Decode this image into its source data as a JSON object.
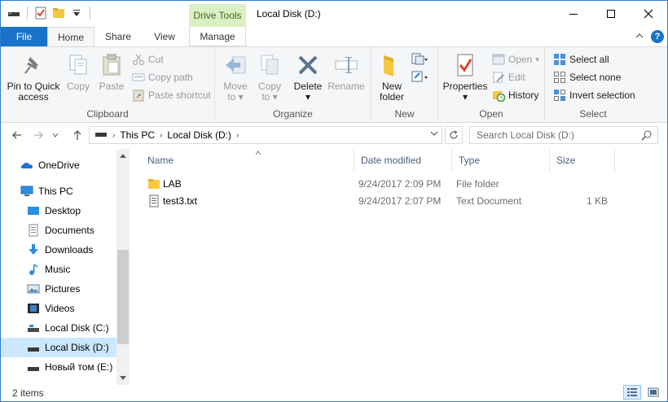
{
  "titlebar": {
    "context_tab": "Drive Tools",
    "title": "Local Disk (D:)",
    "minimize": "—",
    "maximize": "☐",
    "close": "✕"
  },
  "tabs": {
    "file": "File",
    "home": "Home",
    "share": "Share",
    "view": "View",
    "manage": "Manage",
    "help": "?"
  },
  "ribbon": {
    "clipboard": {
      "label": "Clipboard",
      "pin_to_quick_access": "Pin to Quick access",
      "copy": "Copy",
      "paste": "Paste",
      "cut": "Cut",
      "copy_path": "Copy path",
      "paste_shortcut": "Paste shortcut"
    },
    "organize": {
      "label": "Organize",
      "move_to": "Move to",
      "copy_to": "Copy to",
      "delete": "Delete",
      "rename": "Rename"
    },
    "new": {
      "label": "New",
      "new_folder": "New folder"
    },
    "open": {
      "label": "Open",
      "properties": "Properties",
      "open": "Open",
      "edit": "Edit",
      "history": "History"
    },
    "select": {
      "label": "Select",
      "select_all": "Select all",
      "select_none": "Select none",
      "invert_selection": "Invert selection"
    }
  },
  "address": {
    "crumbs": [
      "This PC",
      "Local Disk (D:)"
    ],
    "search_placeholder": "Search Local Disk (D:)"
  },
  "nav": {
    "items": [
      {
        "label": "OneDrive",
        "icon": "onedrive-icon"
      },
      {
        "label": "This PC",
        "icon": "this-pc-icon"
      },
      {
        "label": "Desktop",
        "icon": "desktop-icon"
      },
      {
        "label": "Documents",
        "icon": "documents-icon"
      },
      {
        "label": "Downloads",
        "icon": "downloads-icon"
      },
      {
        "label": "Music",
        "icon": "music-icon"
      },
      {
        "label": "Pictures",
        "icon": "pictures-icon"
      },
      {
        "label": "Videos",
        "icon": "videos-icon"
      },
      {
        "label": "Local Disk (C:)",
        "icon": "drive-icon"
      },
      {
        "label": "Local Disk (D:)",
        "icon": "drive-icon",
        "selected": true
      },
      {
        "label": "Новый том (E:)",
        "icon": "drive-icon"
      }
    ]
  },
  "filelist": {
    "columns": {
      "name": "Name",
      "date_modified": "Date modified",
      "type": "Type",
      "size": "Size"
    },
    "rows": [
      {
        "name": "LAB",
        "date_modified": "9/24/2017 2:09 PM",
        "type": "File folder",
        "size": "",
        "icon": "folder-icon"
      },
      {
        "name": "test3.txt",
        "date_modified": "9/24/2017 2:07 PM",
        "type": "Text Document",
        "size": "1 KB",
        "icon": "text-file-icon"
      }
    ]
  },
  "status": {
    "item_count": "2 items"
  },
  "colors": {
    "accent": "#1a73c8",
    "context_tab_bg": "#dcefc4",
    "selection": "#cce8ff"
  }
}
